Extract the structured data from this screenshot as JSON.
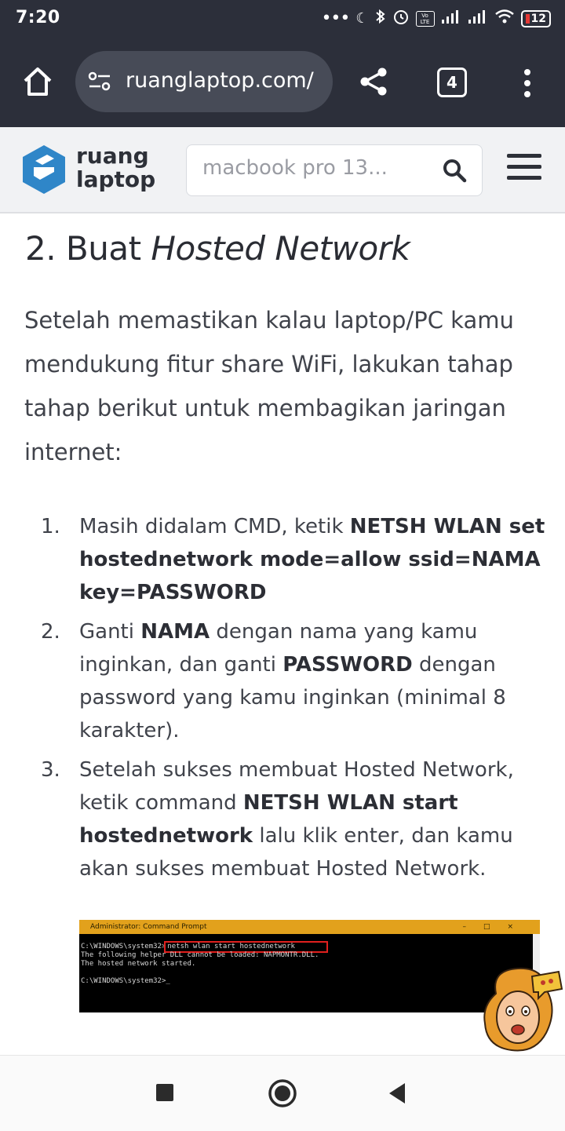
{
  "status_bar": {
    "time": "7:20",
    "battery": "12",
    "volte": "Vo LTE"
  },
  "browser": {
    "url": "ruanglaptop.com/",
    "tab_count": "4",
    "icons": [
      "home-icon",
      "site-info-icon",
      "share-icon",
      "tab-switcher-icon",
      "overflow-menu-icon"
    ]
  },
  "site_header": {
    "logo_line1": "ruang",
    "logo_line2": "laptop",
    "search_placeholder": "macbook pro 13...",
    "brand_color": "#2f86c8"
  },
  "article": {
    "heading_number": "2. Buat ",
    "heading_italic": "Hosted Network",
    "intro": "Setelah memastikan kalau laptop/PC kamu mendukung fitur share WiFi, lakukan tahap tahap berikut untuk membagikan jaringan internet:",
    "steps": [
      {
        "num": "1.",
        "t1": "Masih didalam CMD, ketik ",
        "b1": "NETSH WLAN set hostednetwork mode=allow ssid=NAMA key=PASSWORD"
      },
      {
        "num": "2.",
        "t1": "Ganti ",
        "b1": "NAMA",
        "t2": " dengan nama yang kamu inginkan, dan ganti ",
        "b2": "PASSWORD",
        "t3": " dengan password yang kamu inginkan (minimal 8 karakter)."
      },
      {
        "num": "3.",
        "t1": "Setelah sukses membuat Hosted Network, ketik command ",
        "b1": "NETSH WLAN start hostednetwork",
        "t2": " lalu klik enter, dan kamu akan sukses membuat Hosted Network."
      }
    ],
    "screenshot": {
      "title": "Administrator: Command Prompt",
      "line1_prompt": "C:\\WINDOWS\\system32>",
      "line1_cmd": "netsh wlan start hostednetwork",
      "line2": "The following helper DLL cannot be loaded: NAPMONTR.DLL.",
      "line3": "The hosted network started.",
      "line4": "C:\\WINDOWS\\system32>_"
    }
  },
  "nav_bar": {
    "icons": [
      "recent-apps-icon",
      "home-circle-icon",
      "back-icon"
    ]
  }
}
